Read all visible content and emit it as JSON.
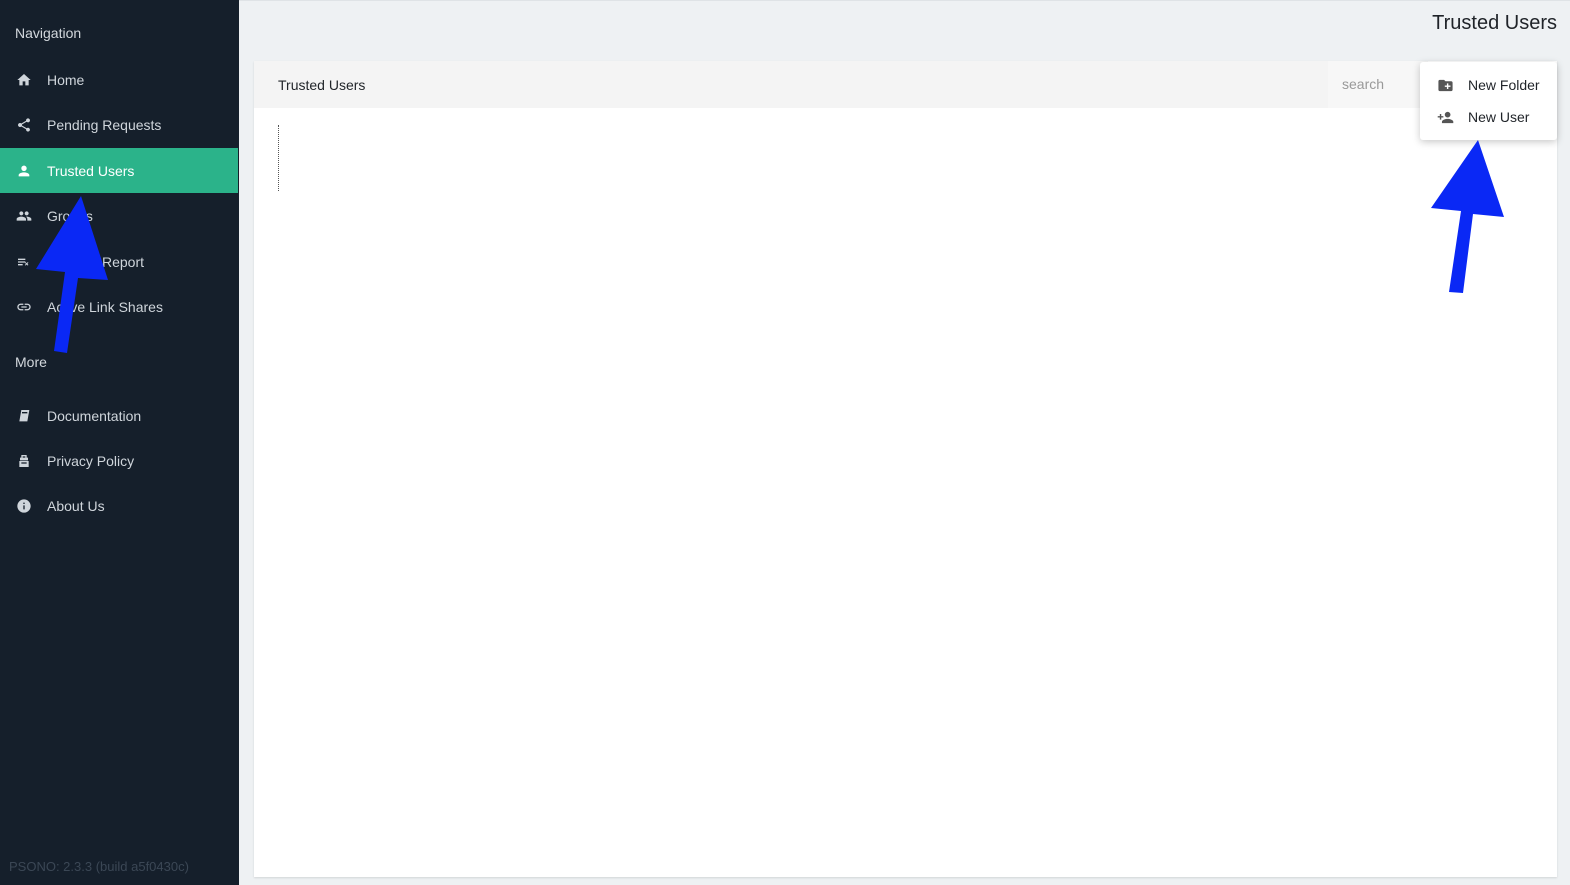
{
  "sidebar": {
    "nav_label": "Navigation",
    "items": [
      {
        "label": "Home",
        "icon": "home-icon"
      },
      {
        "label": "Pending Requests",
        "icon": "share-icon"
      },
      {
        "label": "Trusted Users",
        "icon": "person-icon",
        "active": true
      },
      {
        "label": "Groups",
        "icon": "group-icon"
      },
      {
        "label": "Report",
        "icon": "playlist-remove-icon"
      },
      {
        "label": "Active Link Shares",
        "icon": "link-icon"
      }
    ],
    "more_label": "More",
    "more_items": [
      {
        "label": "Documentation",
        "icon": "book-icon"
      },
      {
        "label": "Privacy Policy",
        "icon": "privacy-icon"
      },
      {
        "label": "About Us",
        "icon": "info-icon"
      }
    ],
    "version": "PSONO: 2.3.3 (build a5f0430c)"
  },
  "header": {
    "title": "Trusted Users"
  },
  "main": {
    "card_title": "Trusted Users",
    "search_placeholder": "search"
  },
  "context_menu": {
    "items": [
      {
        "label": "New Folder",
        "icon": "create-new-folder-icon"
      },
      {
        "label": "New User",
        "icon": "person-add-icon"
      }
    ]
  },
  "colors": {
    "sidebar_bg": "#151f2b",
    "active_item": "#2bb38a",
    "annotation_arrow": "#0a28f5"
  }
}
